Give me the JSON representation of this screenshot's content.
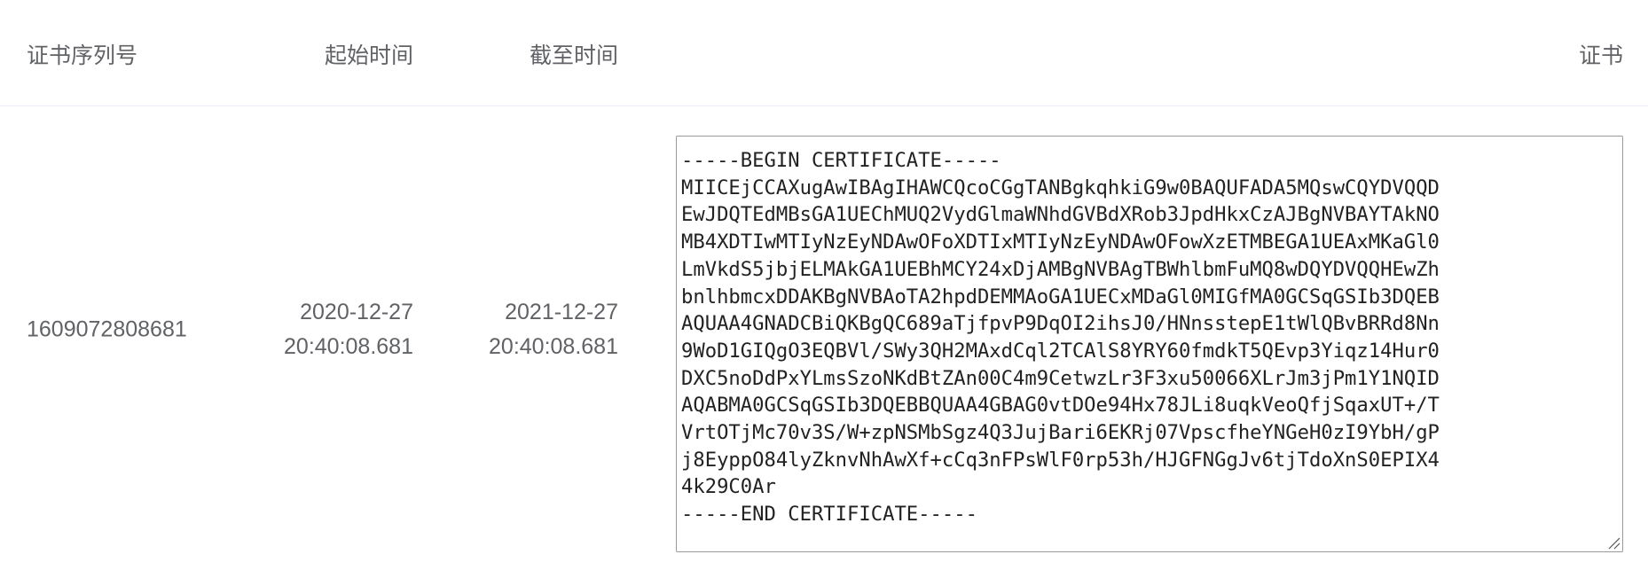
{
  "table": {
    "columns": {
      "serial": "证书序列号",
      "start": "起始时间",
      "end": "截至时间",
      "certificate": "证书"
    },
    "rows": [
      {
        "serial": "1609072808681",
        "start_date": "2020-12-27",
        "start_time": "20:40:08.681",
        "end_date": "2021-12-27",
        "end_time": "20:40:08.681",
        "certificate": "-----BEGIN CERTIFICATE-----\nMIICEjCCAXugAwIBAgIHAWCQcoCGgTANBgkqhkiG9w0BAQUFADA5MQswCQYDVQQD\nEwJDQTEdMBsGA1UEChMUQ2VydGlmaWNhdGVBdXRob3JpdHkxCzAJBgNVBAYTAkNO\nMB4XDTIwMTIyNzEyNDAwOFoXDTIxMTIyNzEyNDAwOFowXzETMBEGA1UEAxMKaGl0\nLmVkdS5jbjELMAkGA1UEBhMCY24xDjAMBgNVBAgTBWhlbmFuMQ8wDQYDVQQHEwZh\nbnlhbmcxDDAKBgNVBAoTA2hpdDEMMAoGA1UECxMDaGl0MIGfMA0GCSqGSIb3DQEB\nAQUAA4GNADCBiQKBgQC689aTjfpvP9DqOI2ihsJ0/HNnsstepE1tWlQBvBRRd8Nn\n9WoD1GIQgO3EQBVl/SWy3QH2MAxdCql2TCAlS8YRY60fmdkT5QEvp3Yiqz14Hur0\nDXC5noDdPxYLmsSzoNKdBtZAn00C4m9CetwzLr3F3xu50066XLrJm3jPm1Y1NQID\nAQABMA0GCSqGSIb3DQEBBQUAA4GBAG0vtDOe94Hx78JLi8uqkVeoQfjSqaxUT+/T\nVrtOTjMc70v3S/W+zpNSMbSgz4Q3JujBari6EKRj07VpscfheYNGeH0zI9YbH/gP\nj8EyppO84lyZknvNhAwXf+cCq3nFPsWlF0rp53h/HJGFNGgJv6tjTdoXnS0EPIX4\n4k29C0Ar\n-----END CERTIFICATE-----"
      }
    ]
  },
  "icons": {
    "resize": "resize-handle-icon"
  },
  "colors": {
    "text": "#606266",
    "divider": "#ebeef5",
    "textarea_border": "#9a9a9a"
  }
}
